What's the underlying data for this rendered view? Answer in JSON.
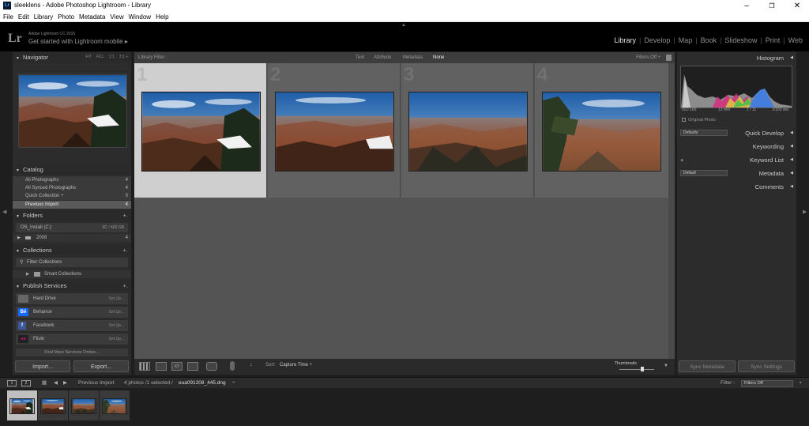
{
  "window": {
    "title": "sleeklens - Adobe Photoshop Lightroom - Library",
    "minimize": "–",
    "maximize": "❐",
    "close": "✕"
  },
  "menu": [
    "File",
    "Edit",
    "Library",
    "Photo",
    "Metadata",
    "View",
    "Window",
    "Help"
  ],
  "identity": {
    "logo": "Lr",
    "version": "Adobe Lightroom CC 2015",
    "mobile": "Get started with Lightroom mobile  ▸"
  },
  "modules": {
    "items": [
      "Library",
      "Develop",
      "Map",
      "Book",
      "Slideshow",
      "Print",
      "Web"
    ],
    "active": "Library"
  },
  "left_panel": {
    "navigator": {
      "title": "Navigator",
      "options": [
        "FIT",
        "FILL",
        "1:1",
        "3:1 ÷"
      ]
    },
    "catalog": {
      "title": "Catalog",
      "items": [
        {
          "label": "All Photographs",
          "count": "4"
        },
        {
          "label": "All Synced Photographs",
          "count": "4"
        },
        {
          "label": "Quick Collection +",
          "count": "0"
        },
        {
          "label": "Previous Import",
          "count": "4"
        }
      ]
    },
    "folders": {
      "title": "Folders",
      "volume": {
        "label": "OS_Install (C:)",
        "size": "9C / 460 GB"
      },
      "items": [
        {
          "label": "2008",
          "count": "4"
        }
      ]
    },
    "collections": {
      "title": "Collections",
      "filter": "Filter Collections",
      "items": [
        {
          "label": "Smart Collections"
        }
      ]
    },
    "publish_services": {
      "title": "Publish Services",
      "items": [
        {
          "label": "Hard Drive",
          "action": "Set Up...",
          "icon": "hard-drive-icon"
        },
        {
          "label": "Behance",
          "action": "Set Up...",
          "icon": "behance-icon",
          "icon_text": "Bē",
          "color": "#1769ff"
        },
        {
          "label": "Facebook",
          "action": "Set Up...",
          "icon": "facebook-icon",
          "icon_text": "f",
          "color": "#3b5998"
        },
        {
          "label": "Flickr",
          "action": "Set Up...",
          "icon": "flickr-icon",
          "icon_text": "●●",
          "color": "#222222"
        }
      ],
      "more": "Find More Services Online..."
    },
    "import_button": "Import...",
    "export_button": "Export..."
  },
  "library_filter": {
    "label": "Library Filter :",
    "options": [
      "Text",
      "Attribute",
      "Metadata",
      "None"
    ],
    "selected": "None",
    "filters_state": "Filters Off  ÷"
  },
  "grid": {
    "cells": [
      {
        "number": "1",
        "selected": true
      },
      {
        "number": "2",
        "selected": false
      },
      {
        "number": "3",
        "selected": false
      },
      {
        "number": "4",
        "selected": false
      }
    ]
  },
  "toolbar": {
    "sort_label": "Sort:",
    "sort_value": "Capture Time  ÷",
    "thumbnails_label": "Thumbnails"
  },
  "right_panel": {
    "histogram": {
      "title": "Histogram",
      "iso": "ISO 100",
      "focal": "13 mm",
      "aperture": "ƒ / 11",
      "shutter": "1/160 sec",
      "original_photo": "Original Photo"
    },
    "quick_develop": {
      "title": "Quick Develop",
      "preset": "Defaults"
    },
    "keywording": {
      "title": "Keywording"
    },
    "keyword_list": {
      "title": "Keyword List",
      "add": "+"
    },
    "metadata": {
      "title": "Metadata",
      "preset": "Default"
    },
    "comments": {
      "title": "Comments"
    },
    "sync_metadata": "Sync Metadata",
    "sync_settings": "Sync Settings"
  },
  "filmstrip": {
    "screen1": "1",
    "screen2": "2",
    "source": "Previous Import",
    "summary": "4 photos /1 selected /",
    "filename": "eua091208_445.dng",
    "filename_suffix": "÷",
    "filter_label": "Filter :",
    "filter_value": "Filters Off"
  },
  "colors": {
    "active_module": "#e4e4e4",
    "panel_bg": "#2c2c2c",
    "grid_bg": "#545454",
    "selected_cell": "#cfcfcf"
  }
}
